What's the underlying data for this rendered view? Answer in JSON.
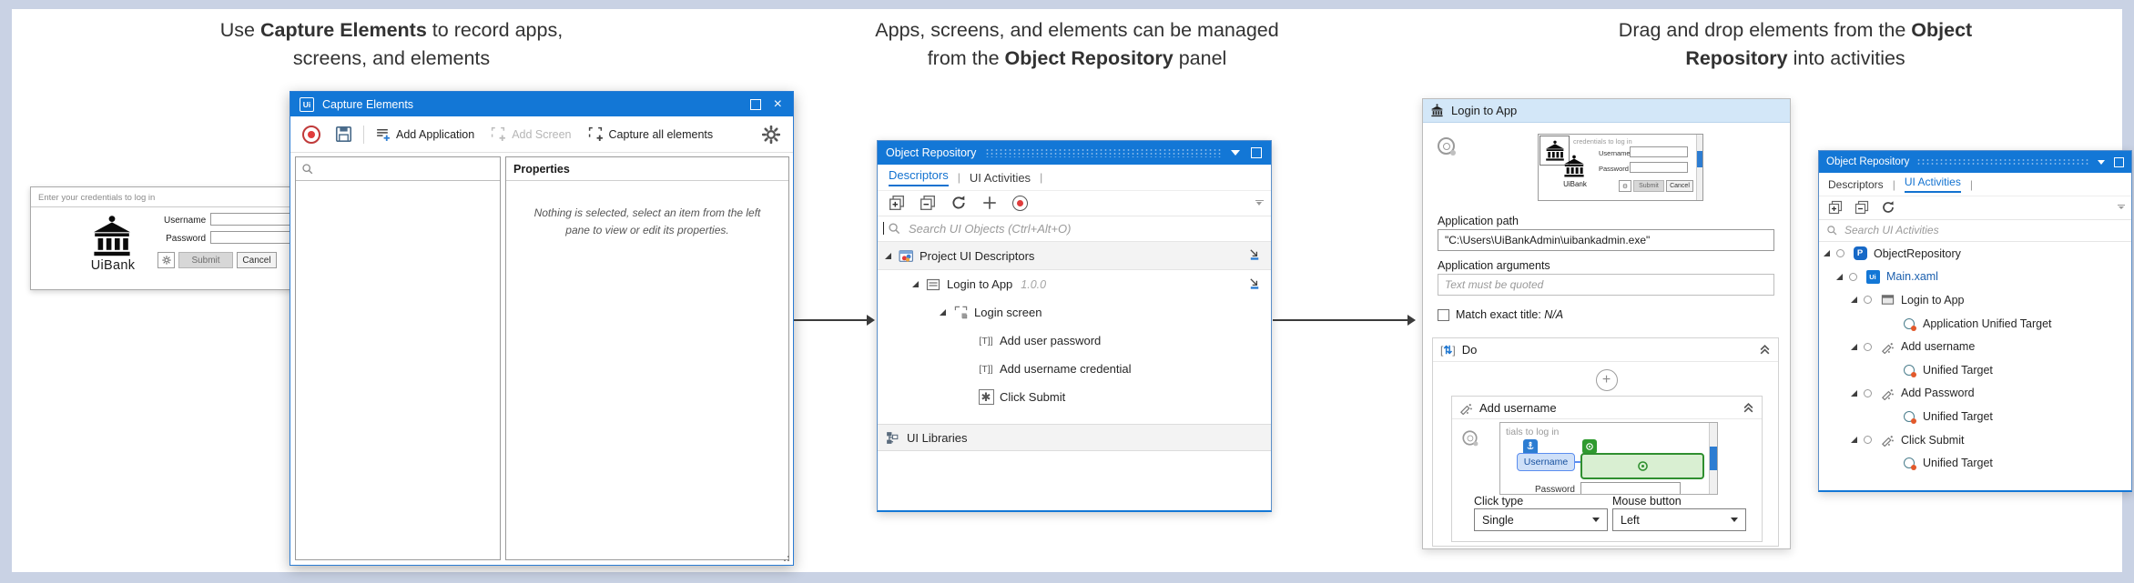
{
  "captions": {
    "c1a": "Use ",
    "c1b": "Capture Elements",
    "c1c": " to record apps,",
    "c1d": "screens, and elements",
    "c2a": "Apps, screens, and elements can be managed",
    "c2b": "from the ",
    "c2c": "Object Repository",
    "c2d": " panel",
    "c3a": "Drag and drop elements from the ",
    "c3b": "Object",
    "c3c": "Repository",
    "c3d": " into activities"
  },
  "uibank": {
    "header": "Enter your credentials to log in",
    "logo": "UiBank",
    "username": "Username",
    "password": "Password",
    "submit": "Submit",
    "cancel": "Cancel"
  },
  "capture": {
    "logo": "Ui",
    "title": "Capture Elements",
    "add_application": "Add Application",
    "add_screen": "Add Screen",
    "capture_all": "Capture all elements",
    "properties": "Properties",
    "empty": "Nothing is selected, select an item from the left pane to view or edit its properties."
  },
  "repo": {
    "title": "Object Repository",
    "tab_descriptors": "Descriptors",
    "tab_activities": "UI Activities",
    "search": "Search UI Objects (Ctrl+Alt+O)",
    "footer": "UI Libraries",
    "tree": [
      {
        "level": 0,
        "icon": "descriptors-folder",
        "label": "Project UI Descriptors",
        "expanded": true,
        "action": true,
        "shaded": true
      },
      {
        "level": 1,
        "icon": "app-card",
        "label": "Login to App",
        "version": "1.0.0",
        "expanded": true,
        "action": true
      },
      {
        "level": 2,
        "icon": "screen-frame",
        "label": "Login screen",
        "expanded": true
      },
      {
        "level": 3,
        "icon": "text-t",
        "label": "Add user password"
      },
      {
        "level": 3,
        "icon": "text-t",
        "label": "Add username credential"
      },
      {
        "level": 3,
        "icon": "star-box",
        "label": "Click Submit"
      }
    ]
  },
  "activity": {
    "title": "Login to App",
    "path_label": "Application path",
    "path_value": "\"C:\\Users\\UiBankAdmin\\uibankadmin.exe\"",
    "args_label": "Application arguments",
    "args_placeholder": "Text must be quoted",
    "match_label": "Match exact title:",
    "match_value": "N/A",
    "do_label": "Do",
    "thumb": {
      "snippet": "credentials to log in",
      "logo": "UiBank",
      "username": "Username",
      "password": "Password",
      "submit": "Submit",
      "cancel": "Cancel"
    },
    "card": {
      "title": "Add username",
      "snippet": "tials to log in",
      "anchor": "Username",
      "password": "Password",
      "click_type_label": "Click type",
      "click_type_value": "Single",
      "mouse_button_label": "Mouse button",
      "mouse_button_value": "Left"
    }
  },
  "repo2": {
    "title": "Object Repository",
    "tab_descriptors": "Descriptors",
    "tab_activities": "UI Activities",
    "search": "Search UI Activities",
    "tree": [
      {
        "level": 0,
        "icon": "project-hex",
        "label": "ObjectRepository",
        "expanded": true,
        "circle": true
      },
      {
        "level": 1,
        "icon": "ui-file",
        "label": "Main.xaml",
        "expanded": true,
        "circle": true,
        "blue": true
      },
      {
        "level": 2,
        "icon": "window-app",
        "label": "Login to App",
        "expanded": true,
        "circle": true
      },
      {
        "level": 3,
        "icon": "target",
        "label": "Application Unified Target"
      },
      {
        "level": 2,
        "icon": "type-into",
        "label": "Add username",
        "expanded": true,
        "circle": true
      },
      {
        "level": 3,
        "icon": "target",
        "label": "Unified Target"
      },
      {
        "level": 2,
        "icon": "type-into",
        "label": "Add Password",
        "expanded": true,
        "circle": true
      },
      {
        "level": 3,
        "icon": "target",
        "label": "Unified Target"
      },
      {
        "level": 2,
        "icon": "type-into",
        "label": "Click Submit",
        "expanded": true,
        "circle": true
      },
      {
        "level": 3,
        "icon": "target",
        "label": "Unified Target"
      }
    ]
  }
}
